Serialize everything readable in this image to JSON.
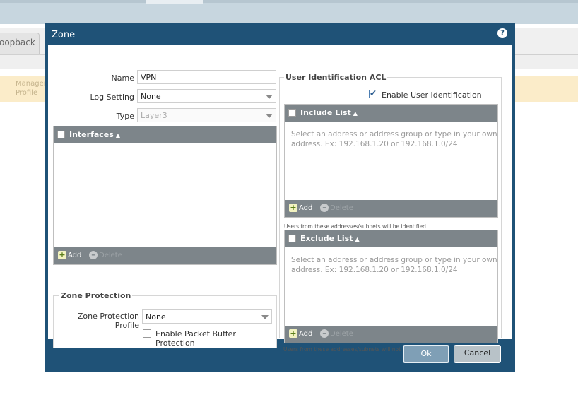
{
  "background": {
    "tab_label": "oopback",
    "row_text_line1": "Managem",
    "row_text_line2": "Profile"
  },
  "dialog": {
    "title": "Zone",
    "help_icon": "help-icon"
  },
  "form": {
    "name_label": "Name",
    "name_value": "VPN",
    "log_setting_label": "Log Setting",
    "log_setting_value": "None",
    "type_label": "Type",
    "type_value": "Layer3"
  },
  "interfaces": {
    "header": "Interfaces",
    "add_label": "Add",
    "delete_label": "Delete"
  },
  "zone_protection": {
    "title": "Zone Protection",
    "profile_label": "Zone Protection Profile",
    "profile_value": "None",
    "packet_buffer_label": "Enable Packet Buffer Protection",
    "packet_buffer_checked": false
  },
  "user_id_acl": {
    "title": "User Identification ACL",
    "enable_label": "Enable User Identification",
    "enable_checked": true,
    "include_list": {
      "header": "Include List",
      "hint_line1": "Select an address or address group or type in your own",
      "hint_line2": "address. Ex: 192.168.1.20 or 192.168.1.0/24",
      "add_label": "Add",
      "delete_label": "Delete",
      "note": "Users from these addresses/subnets will be identified."
    },
    "exclude_list": {
      "header": "Exclude List",
      "hint_line1": "Select an address or address group or type in your own",
      "hint_line2": "address. Ex: 192.168.1.20 or 192.168.1.0/24",
      "add_label": "Add",
      "delete_label": "Delete",
      "note": "Users from these addresses/subnets will not be identified."
    }
  },
  "buttons": {
    "ok_label": "Ok",
    "cancel_label": "Cancel"
  },
  "colors": {
    "dialog_frame": "#1f5277",
    "grid_header": "#7d858a",
    "background_notice": "#fbecc9"
  }
}
